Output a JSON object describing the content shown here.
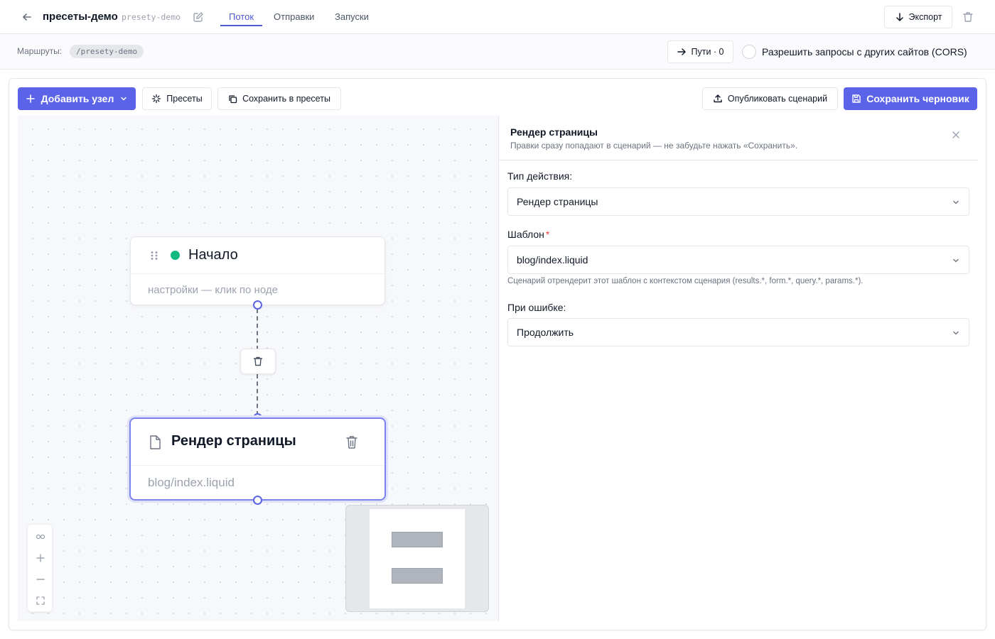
{
  "header": {
    "project_title": "пресеты-демо",
    "project_slug": "presety-demo",
    "tabs": [
      {
        "label": "Поток",
        "active": true
      },
      {
        "label": "Отправки",
        "active": false
      },
      {
        "label": "Запуски",
        "active": false
      }
    ],
    "export_label": "Экспорт"
  },
  "routes": {
    "label": "Маршруты:",
    "chip": "/presety-demo",
    "paths_label": "Пути · 0",
    "cors_label": "Разрешить запросы с других сайтов (CORS)",
    "cors_checked": false
  },
  "toolbar": {
    "add_node_label": "Добавить узел",
    "presets_label": "Пресеты",
    "save_to_presets_label": "Сохранить в пресеты",
    "publish_label": "Опубликовать сценарий",
    "save_draft_label": "Сохранить черновик"
  },
  "canvas": {
    "start_node": {
      "title": "Начало",
      "subtitle": "настройки — клик по ноде"
    },
    "render_node": {
      "title": "Рендер страницы",
      "subtitle": "blog/index.liquid",
      "selected": true
    }
  },
  "panel": {
    "title": "Рендер страницы",
    "hint": "Правки сразу попадают в сценарий — не забудьте нажать «Сохранить».",
    "action_type_label": "Тип действия:",
    "action_type_value": "Рендер страницы",
    "template_label": "Шаблон",
    "template_value": "blog/index.liquid",
    "template_help": "Сценарий отрендерит этот шаблон с контекстом сценария (results.*, form.*, query.*, params.*).",
    "on_error_label": "При ошибке:",
    "on_error_value": "Продолжить"
  },
  "colors": {
    "accent": "#5b63e8",
    "start_dot": "#10b981",
    "required": "#ef4444"
  }
}
